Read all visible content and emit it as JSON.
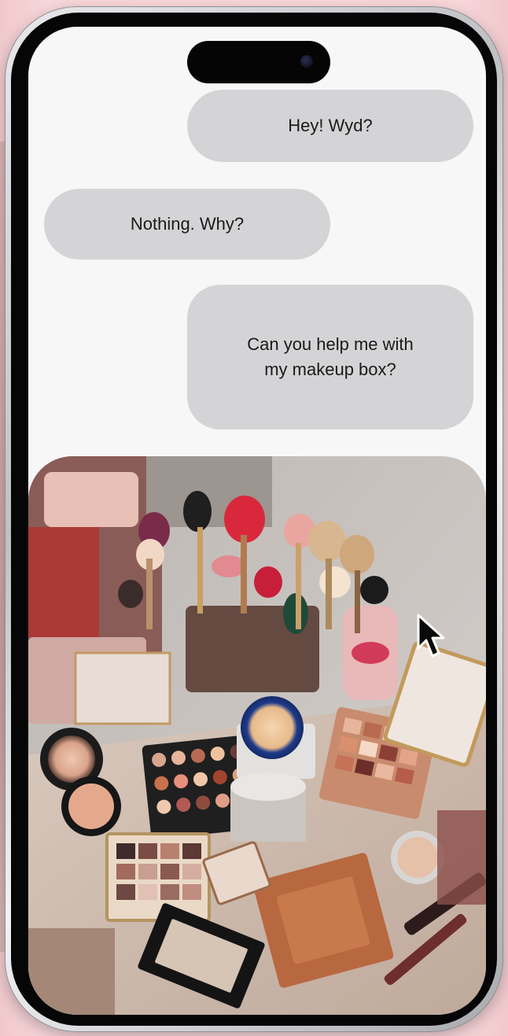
{
  "messages": [
    {
      "side": "sent",
      "text": "Hey! Wyd?"
    },
    {
      "side": "received",
      "text": "Nothing. Why?"
    },
    {
      "side": "sent",
      "text": "Can you help me with\nmy makeup box?"
    }
  ],
  "photo": {
    "subject_icon": "makeup-collection-photo"
  },
  "colors": {
    "background": "#f8d7da",
    "screen": "#f7f7f8",
    "bubble": "#d4d4d6",
    "text": "#1a1a1a"
  }
}
